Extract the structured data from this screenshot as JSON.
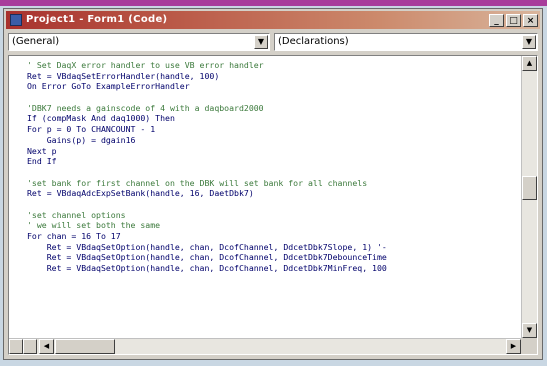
{
  "window": {
    "title": "Project1 - Form1 (Code)",
    "minimize": "_",
    "maximize": "□",
    "close": "×"
  },
  "object_combo": {
    "value": "(General)"
  },
  "procedure_combo": {
    "value": "(Declarations)"
  },
  "code_lines": [
    {
      "text": "' Set DaqX error handler to use VB error handler",
      "type": "comment"
    },
    {
      "text": "Ret = VBdaqSetErrorHandler(handle, 100)",
      "type": "code"
    },
    {
      "text": "On Error GoTo ExampleErrorHandler",
      "type": "code"
    },
    {
      "text": "",
      "type": "code"
    },
    {
      "text": "'DBK7 needs a gainscode of 4 with a daqboard2000",
      "type": "comment"
    },
    {
      "text": "If (compMask And daq1000) Then",
      "type": "code"
    },
    {
      "text": "For p = 0 To CHANCOUNT - 1",
      "type": "code"
    },
    {
      "text": "    Gains(p) = dgain16",
      "type": "code"
    },
    {
      "text": "Next p",
      "type": "code"
    },
    {
      "text": "End If",
      "type": "code"
    },
    {
      "text": "",
      "type": "code"
    },
    {
      "text": "'set bank for first channel on the DBK will set bank for all channels",
      "type": "comment"
    },
    {
      "text": "Ret = VBdaqAdcExpSetBank(handle, 16, DaetDbk7)",
      "type": "code"
    },
    {
      "text": "",
      "type": "code"
    },
    {
      "text": "'set channel options",
      "type": "comment"
    },
    {
      "text": "' we will set both the same",
      "type": "comment"
    },
    {
      "text": "For chan = 16 To 17",
      "type": "code"
    },
    {
      "text": "    Ret = VBdaqSetOption(handle, chan, DcofChannel, DdcetDbk7Slope, 1) '-",
      "type": "code"
    },
    {
      "text": "    Ret = VBdaqSetOption(handle, chan, DcofChannel, DdcetDbk7DebounceTime",
      "type": "code"
    },
    {
      "text": "    Ret = VBdaqSetOption(handle, chan, DcofChannel, DdcetDbk7MinFreq, 100",
      "type": "code"
    }
  ]
}
